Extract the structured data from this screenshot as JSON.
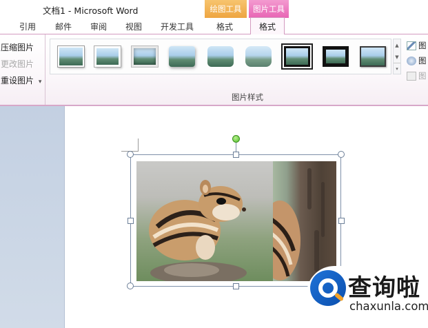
{
  "window": {
    "title": "文档1 - Microsoft Word"
  },
  "context_tabs": {
    "drawing_tools": "绘图工具",
    "picture_tools": "图片工具"
  },
  "tabs": [
    {
      "label": "引用"
    },
    {
      "label": "邮件"
    },
    {
      "label": "审阅"
    },
    {
      "label": "视图"
    },
    {
      "label": "开发工具"
    },
    {
      "label": "格式"
    },
    {
      "label": "格式",
      "active": true
    }
  ],
  "ribbon": {
    "adjust": {
      "compress": "压缩图片",
      "change": "更改图片",
      "reset": "重设图片",
      "reset_arrow": "▾"
    },
    "picture_styles": {
      "group_label": "图片样式",
      "thumbnail_count": 9
    },
    "side": {
      "border": "图",
      "effects": "图",
      "layout": "图"
    },
    "scroll": {
      "up": "▲",
      "down": "▼",
      "more": "▾"
    }
  },
  "watermark": {
    "brand_cn": "查询啦",
    "brand_en": "chaxunla.com"
  },
  "colors": {
    "picture_tools_tab": "#e865b4",
    "drawing_tools_tab": "#eea541",
    "ribbon_border": "#d39ac0",
    "rotation_handle": "#4fbf2a",
    "logo_blue": "#1f73d8"
  }
}
